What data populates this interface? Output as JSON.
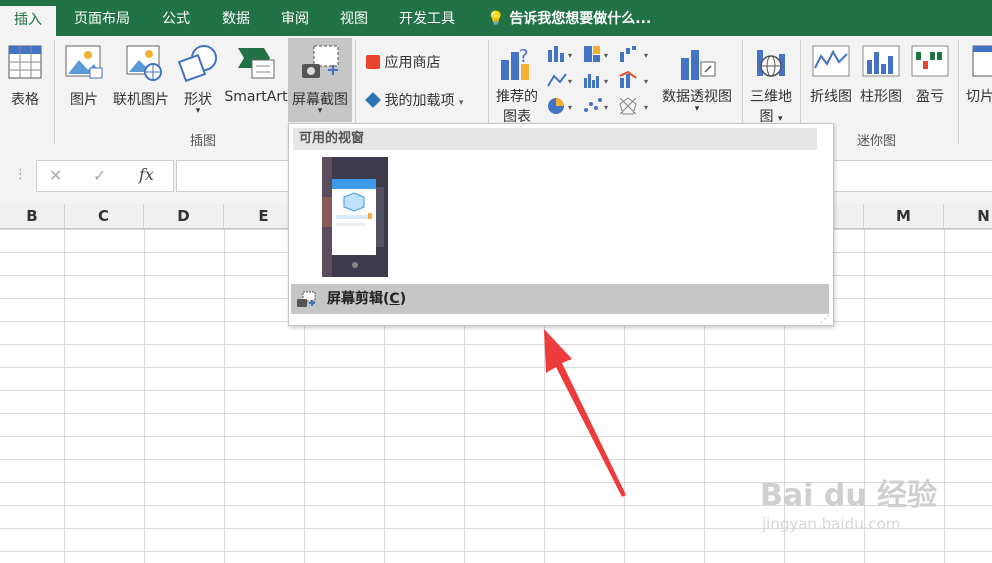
{
  "tabs": {
    "insert": "插入",
    "page_layout": "页面布局",
    "formulas": "公式",
    "data": "数据",
    "review": "审阅",
    "view": "视图",
    "developer": "开发工具",
    "tell_me": "告诉我您想要做什么..."
  },
  "ribbon": {
    "table": "表格",
    "picture": "图片",
    "online_picture": "联机图片",
    "shapes": "形状",
    "smartart": "SmartArt",
    "screenshot": "屏幕截图",
    "app_store": "应用商店",
    "my_addins": "我的加载项",
    "recommended_charts_1": "推荐的",
    "recommended_charts_2": "图表",
    "pivot_chart": "数据透视图",
    "map_3d_1": "三维地",
    "map_3d_2": "图",
    "line": "折线图",
    "column": "柱形图",
    "win_loss": "盈亏",
    "slicer": "切片",
    "group_illustrations": "插图",
    "group_sparklines": "迷你图"
  },
  "formula_bar": {
    "cancel": "✕",
    "enter": "✓",
    "fx": "fx"
  },
  "columns": [
    "B",
    "C",
    "D",
    "E",
    "M",
    "N"
  ],
  "dropdown": {
    "header": "可用的视窗",
    "screen_clipping_prefix": "屏幕剪辑(",
    "screen_clipping_key": "C",
    "screen_clipping_suffix": ")"
  },
  "watermark": {
    "brand": "Bai du 经验",
    "url": "jingyan.baidu.com"
  },
  "colors": {
    "excel_green": "#217346",
    "arrow_red": "#ee3b3b"
  }
}
